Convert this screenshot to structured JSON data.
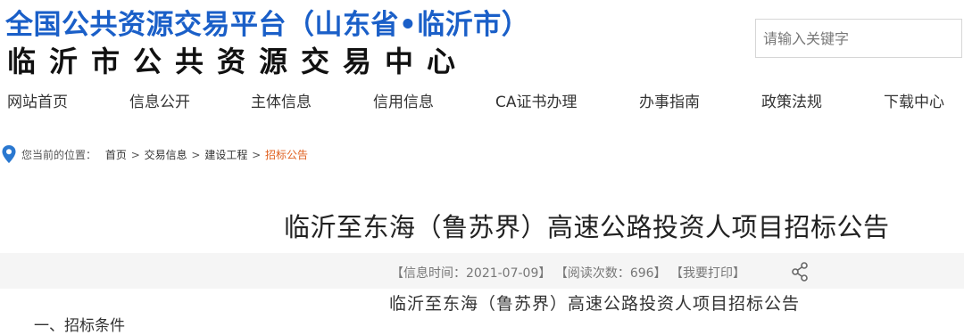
{
  "header": {
    "title": "全国公共资源交易平台（山东省•临沂市）",
    "subtitle": "临沂市公共资源交易中心"
  },
  "search": {
    "placeholder": "请输入关键字"
  },
  "nav": {
    "items": [
      {
        "label": "网站首页"
      },
      {
        "label": "信息公开"
      },
      {
        "label": "主体信息"
      },
      {
        "label": "信用信息"
      },
      {
        "label": "CA证书办理"
      },
      {
        "label": "办事指南"
      },
      {
        "label": "政策法规"
      },
      {
        "label": "下载中心"
      }
    ]
  },
  "breadcrumb": {
    "prefix": "您当前的位置：",
    "items": [
      {
        "label": "首页"
      },
      {
        "label": "交易信息"
      },
      {
        "label": "建设工程"
      },
      {
        "label": "招标公告"
      }
    ],
    "separator": ">"
  },
  "article": {
    "title": "临沂至东海（鲁苏界）高速公路投资人项目招标公告",
    "meta": {
      "time": "【信息时间：2021-07-09】",
      "views": "【阅读次数：696】",
      "print": "【我要打印】"
    },
    "subtitle": "临沂至东海（鲁苏界）高速公路投资人项目招标公告",
    "cut_text": "一、招标条件"
  },
  "icons": {
    "location": "location-pin-icon",
    "share": "share-icon"
  },
  "colors": {
    "brand_blue": "#1a5fc8",
    "current_crumb": "#e06020",
    "pin_blue": "#2a78d0"
  }
}
